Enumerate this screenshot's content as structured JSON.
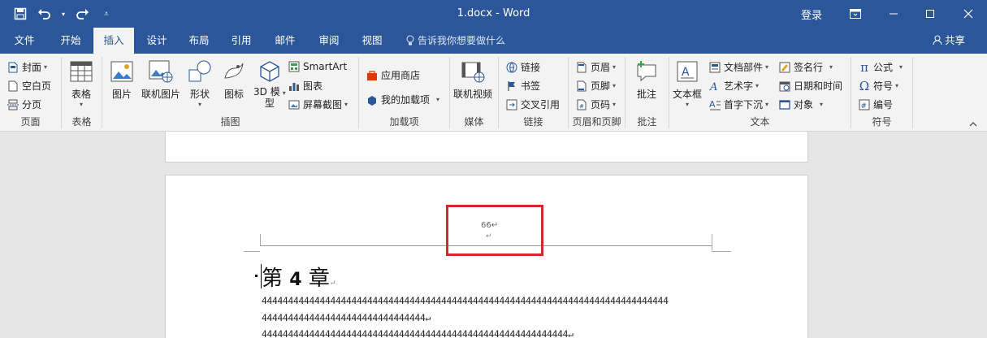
{
  "window": {
    "title": "1.docx  -  Word",
    "login": "登录"
  },
  "qat": {
    "save_icon": "save-icon",
    "undo_icon": "undo-icon",
    "redo_icon": "redo-icon",
    "customize_icon": "customize-icon"
  },
  "tabs": [
    "文件",
    "开始",
    "插入",
    "设计",
    "布局",
    "引用",
    "邮件",
    "审阅",
    "视图"
  ],
  "active_tab": "插入",
  "tell_me": "告诉我你想要做什么",
  "share": "共享",
  "ribbon": {
    "pages": {
      "cover": "封面",
      "blank": "空白页",
      "break": "分页",
      "label": "页面"
    },
    "tables": {
      "table": "表格",
      "label": "表格"
    },
    "illustrations": {
      "picture": "图片",
      "online_picture": "联机图片",
      "shapes": "形状",
      "icons": "图标",
      "model3d_1": "3D 模",
      "model3d_2": "型",
      "smartart": "SmartArt",
      "chart": "图表",
      "screenshot": "屏幕截图",
      "label": "插图"
    },
    "addins": {
      "store": "应用商店",
      "my_addins": "我的加载项",
      "label": "加载项"
    },
    "media": {
      "online_video": "联机视频",
      "label": "媒体"
    },
    "links": {
      "link": "链接",
      "bookmark": "书签",
      "cross_ref": "交叉引用",
      "label": "链接"
    },
    "header_footer": {
      "header": "页眉",
      "footer": "页脚",
      "page_number": "页码",
      "label": "页眉和页脚"
    },
    "comments": {
      "comment": "批注",
      "label": "批注"
    },
    "text": {
      "textbox": "文本框",
      "quick_parts": "文档部件",
      "wordart": "艺术字",
      "drop_cap": "首字下沉",
      "signature": "签名行",
      "datetime": "日期和时间",
      "object": "对象",
      "label": "文本"
    },
    "symbols": {
      "equation": "公式",
      "symbol": "符号",
      "number": "编号",
      "label": "符号"
    }
  },
  "document": {
    "page_number": "66↵",
    "header_para": "↵",
    "heading_pre": "第 ",
    "heading_num": "4",
    "heading_post": " 章",
    "heading_mark": "↵",
    "line1": "44444444444444444444444444444444444444444444444444444444444444444444444444444",
    "line2": "4444444444444444444444444444444↵",
    "line3": "4444444444444444444444444444444444444444444444444444444444↵"
  },
  "colors": {
    "title_bar": "#2b579a",
    "ribbon_bg": "#f3f3f3",
    "highlight_box": "#d42929"
  }
}
